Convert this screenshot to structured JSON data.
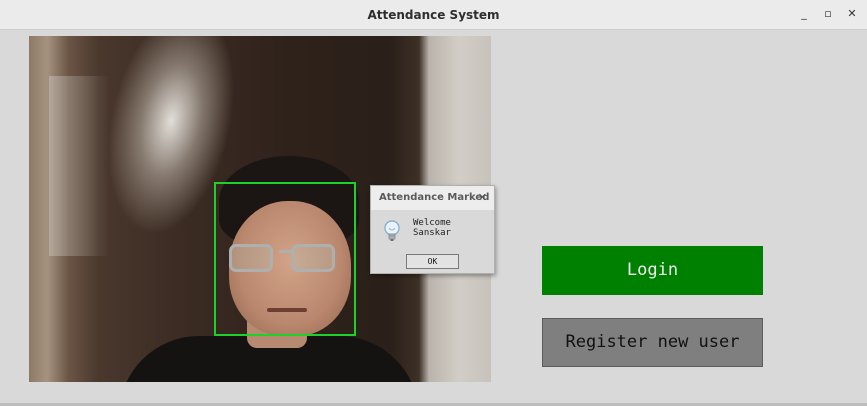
{
  "window": {
    "title": "Attendance System",
    "controls": {
      "minimize": "_",
      "maximize": "▫",
      "close": "✕"
    }
  },
  "dialog": {
    "title": "Attendance Marked",
    "close": "✕",
    "message": "Welcome Sanskar",
    "ok_label": "OK",
    "icon": "lightbulb-icon"
  },
  "buttons": {
    "login_label": "Login",
    "register_label": "Register new user"
  },
  "colors": {
    "login_bg": "#008000",
    "register_bg": "#7f7f7f",
    "face_box": "#20d02a"
  }
}
